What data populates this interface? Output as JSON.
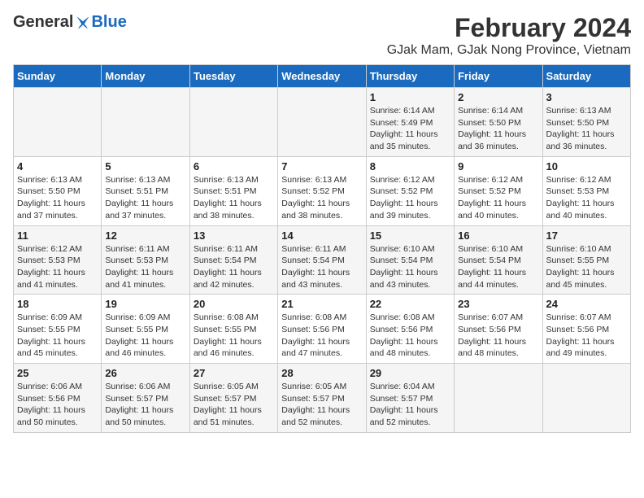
{
  "header": {
    "logo_general": "General",
    "logo_blue": "Blue",
    "month_year": "February 2024",
    "location": "GJak Mam, GJak Nong Province, Vietnam"
  },
  "weekdays": [
    "Sunday",
    "Monday",
    "Tuesday",
    "Wednesday",
    "Thursday",
    "Friday",
    "Saturday"
  ],
  "weeks": [
    [
      {
        "day": "",
        "detail": ""
      },
      {
        "day": "",
        "detail": ""
      },
      {
        "day": "",
        "detail": ""
      },
      {
        "day": "",
        "detail": ""
      },
      {
        "day": "1",
        "detail": "Sunrise: 6:14 AM\nSunset: 5:49 PM\nDaylight: 11 hours\nand 35 minutes."
      },
      {
        "day": "2",
        "detail": "Sunrise: 6:14 AM\nSunset: 5:50 PM\nDaylight: 11 hours\nand 36 minutes."
      },
      {
        "day": "3",
        "detail": "Sunrise: 6:13 AM\nSunset: 5:50 PM\nDaylight: 11 hours\nand 36 minutes."
      }
    ],
    [
      {
        "day": "4",
        "detail": "Sunrise: 6:13 AM\nSunset: 5:50 PM\nDaylight: 11 hours\nand 37 minutes."
      },
      {
        "day": "5",
        "detail": "Sunrise: 6:13 AM\nSunset: 5:51 PM\nDaylight: 11 hours\nand 37 minutes."
      },
      {
        "day": "6",
        "detail": "Sunrise: 6:13 AM\nSunset: 5:51 PM\nDaylight: 11 hours\nand 38 minutes."
      },
      {
        "day": "7",
        "detail": "Sunrise: 6:13 AM\nSunset: 5:52 PM\nDaylight: 11 hours\nand 38 minutes."
      },
      {
        "day": "8",
        "detail": "Sunrise: 6:12 AM\nSunset: 5:52 PM\nDaylight: 11 hours\nand 39 minutes."
      },
      {
        "day": "9",
        "detail": "Sunrise: 6:12 AM\nSunset: 5:52 PM\nDaylight: 11 hours\nand 40 minutes."
      },
      {
        "day": "10",
        "detail": "Sunrise: 6:12 AM\nSunset: 5:53 PM\nDaylight: 11 hours\nand 40 minutes."
      }
    ],
    [
      {
        "day": "11",
        "detail": "Sunrise: 6:12 AM\nSunset: 5:53 PM\nDaylight: 11 hours\nand 41 minutes."
      },
      {
        "day": "12",
        "detail": "Sunrise: 6:11 AM\nSunset: 5:53 PM\nDaylight: 11 hours\nand 41 minutes."
      },
      {
        "day": "13",
        "detail": "Sunrise: 6:11 AM\nSunset: 5:54 PM\nDaylight: 11 hours\nand 42 minutes."
      },
      {
        "day": "14",
        "detail": "Sunrise: 6:11 AM\nSunset: 5:54 PM\nDaylight: 11 hours\nand 43 minutes."
      },
      {
        "day": "15",
        "detail": "Sunrise: 6:10 AM\nSunset: 5:54 PM\nDaylight: 11 hours\nand 43 minutes."
      },
      {
        "day": "16",
        "detail": "Sunrise: 6:10 AM\nSunset: 5:54 PM\nDaylight: 11 hours\nand 44 minutes."
      },
      {
        "day": "17",
        "detail": "Sunrise: 6:10 AM\nSunset: 5:55 PM\nDaylight: 11 hours\nand 45 minutes."
      }
    ],
    [
      {
        "day": "18",
        "detail": "Sunrise: 6:09 AM\nSunset: 5:55 PM\nDaylight: 11 hours\nand 45 minutes."
      },
      {
        "day": "19",
        "detail": "Sunrise: 6:09 AM\nSunset: 5:55 PM\nDaylight: 11 hours\nand 46 minutes."
      },
      {
        "day": "20",
        "detail": "Sunrise: 6:08 AM\nSunset: 5:55 PM\nDaylight: 11 hours\nand 46 minutes."
      },
      {
        "day": "21",
        "detail": "Sunrise: 6:08 AM\nSunset: 5:56 PM\nDaylight: 11 hours\nand 47 minutes."
      },
      {
        "day": "22",
        "detail": "Sunrise: 6:08 AM\nSunset: 5:56 PM\nDaylight: 11 hours\nand 48 minutes."
      },
      {
        "day": "23",
        "detail": "Sunrise: 6:07 AM\nSunset: 5:56 PM\nDaylight: 11 hours\nand 48 minutes."
      },
      {
        "day": "24",
        "detail": "Sunrise: 6:07 AM\nSunset: 5:56 PM\nDaylight: 11 hours\nand 49 minutes."
      }
    ],
    [
      {
        "day": "25",
        "detail": "Sunrise: 6:06 AM\nSunset: 5:56 PM\nDaylight: 11 hours\nand 50 minutes."
      },
      {
        "day": "26",
        "detail": "Sunrise: 6:06 AM\nSunset: 5:57 PM\nDaylight: 11 hours\nand 50 minutes."
      },
      {
        "day": "27",
        "detail": "Sunrise: 6:05 AM\nSunset: 5:57 PM\nDaylight: 11 hours\nand 51 minutes."
      },
      {
        "day": "28",
        "detail": "Sunrise: 6:05 AM\nSunset: 5:57 PM\nDaylight: 11 hours\nand 52 minutes."
      },
      {
        "day": "29",
        "detail": "Sunrise: 6:04 AM\nSunset: 5:57 PM\nDaylight: 11 hours\nand 52 minutes."
      },
      {
        "day": "",
        "detail": ""
      },
      {
        "day": "",
        "detail": ""
      }
    ]
  ]
}
